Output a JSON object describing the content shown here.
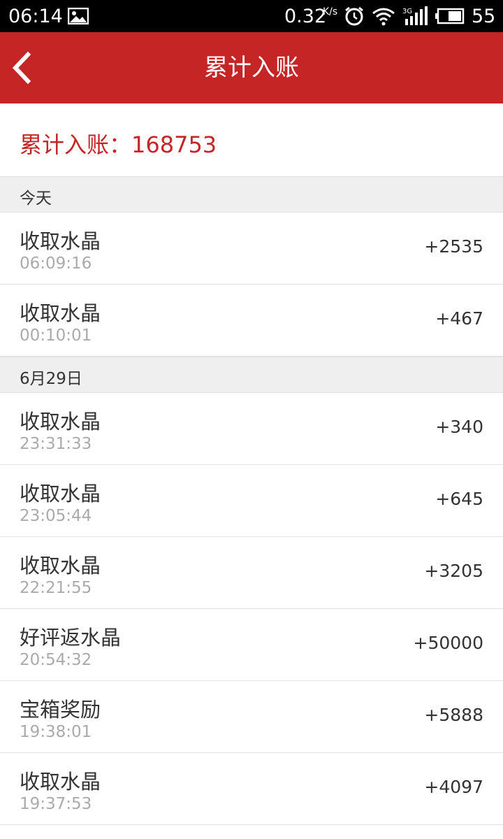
{
  "status_bar": {
    "time": "06:14",
    "net_speed": "0.32",
    "net_speed_unit": "K/s",
    "signal_type": "3G",
    "battery": "55"
  },
  "header": {
    "title": "累计入账"
  },
  "summary": {
    "text": "累计入账：168753"
  },
  "sections": [
    {
      "label": "今天",
      "rows": [
        {
          "title": "收取水晶",
          "time": "06:09:16",
          "amount": "+2535"
        },
        {
          "title": "收取水晶",
          "time": "00:10:01",
          "amount": "+467"
        }
      ]
    },
    {
      "label": "6月29日",
      "rows": [
        {
          "title": "收取水晶",
          "time": "23:31:33",
          "amount": "+340"
        },
        {
          "title": "收取水晶",
          "time": "23:05:44",
          "amount": "+645"
        },
        {
          "title": "收取水晶",
          "time": "22:21:55",
          "amount": "+3205"
        },
        {
          "title": "好评返水晶",
          "time": "20:54:32",
          "amount": "+50000"
        },
        {
          "title": "宝箱奖励",
          "time": "19:38:01",
          "amount": "+5888"
        },
        {
          "title": "收取水晶",
          "time": "19:37:53",
          "amount": "+4097"
        }
      ]
    }
  ],
  "colors": {
    "accent": "#c62525",
    "section_bg": "#efefef"
  }
}
